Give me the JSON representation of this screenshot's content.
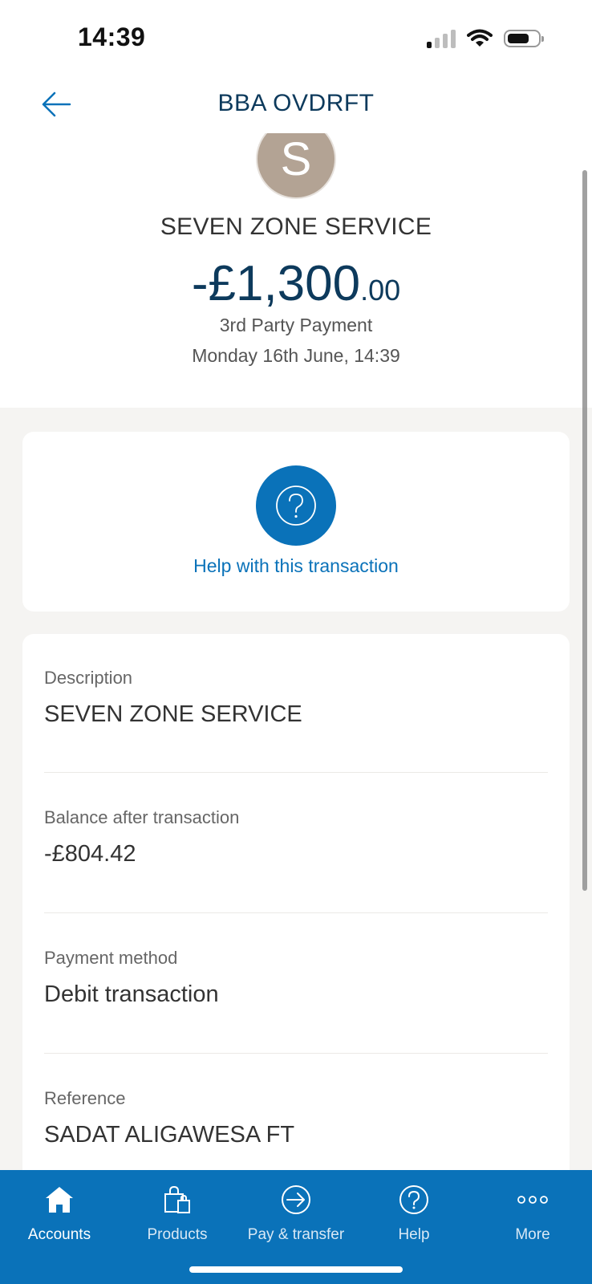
{
  "status_bar": {
    "time": "14:39"
  },
  "header": {
    "title": "BBA OVDRFT"
  },
  "transaction": {
    "avatar_letter": "S",
    "payee": "SEVEN ZONE SERVICE",
    "amount_main": "-£1,300",
    "amount_pence": ".00",
    "type": "3rd Party Payment",
    "date": "Monday 16th June, 14:39"
  },
  "help": {
    "link_label": "Help with this transaction"
  },
  "details": [
    {
      "label": "Description",
      "value": "SEVEN ZONE SERVICE"
    },
    {
      "label": "Balance after transaction",
      "value": "-£804.42"
    },
    {
      "label": "Payment method",
      "value": "Debit transaction"
    },
    {
      "label": "Reference",
      "value": "SADAT ALIGAWESA FT"
    }
  ],
  "tabbar": {
    "active": "Accounts",
    "tabs": [
      {
        "label": "Accounts",
        "icon": "home-icon"
      },
      {
        "label": "Products",
        "icon": "shopping-bag-icon"
      },
      {
        "label": "Pay & transfer",
        "icon": "transfer-arrow-icon"
      },
      {
        "label": "Help",
        "icon": "help-icon"
      },
      {
        "label": "More",
        "icon": "more-dots-icon"
      }
    ]
  },
  "colors": {
    "brand_blue": "#0a72b9",
    "navy_text": "#0d3a5c",
    "avatar_bg": "#b3a394",
    "page_bg": "#f5f4f2"
  }
}
